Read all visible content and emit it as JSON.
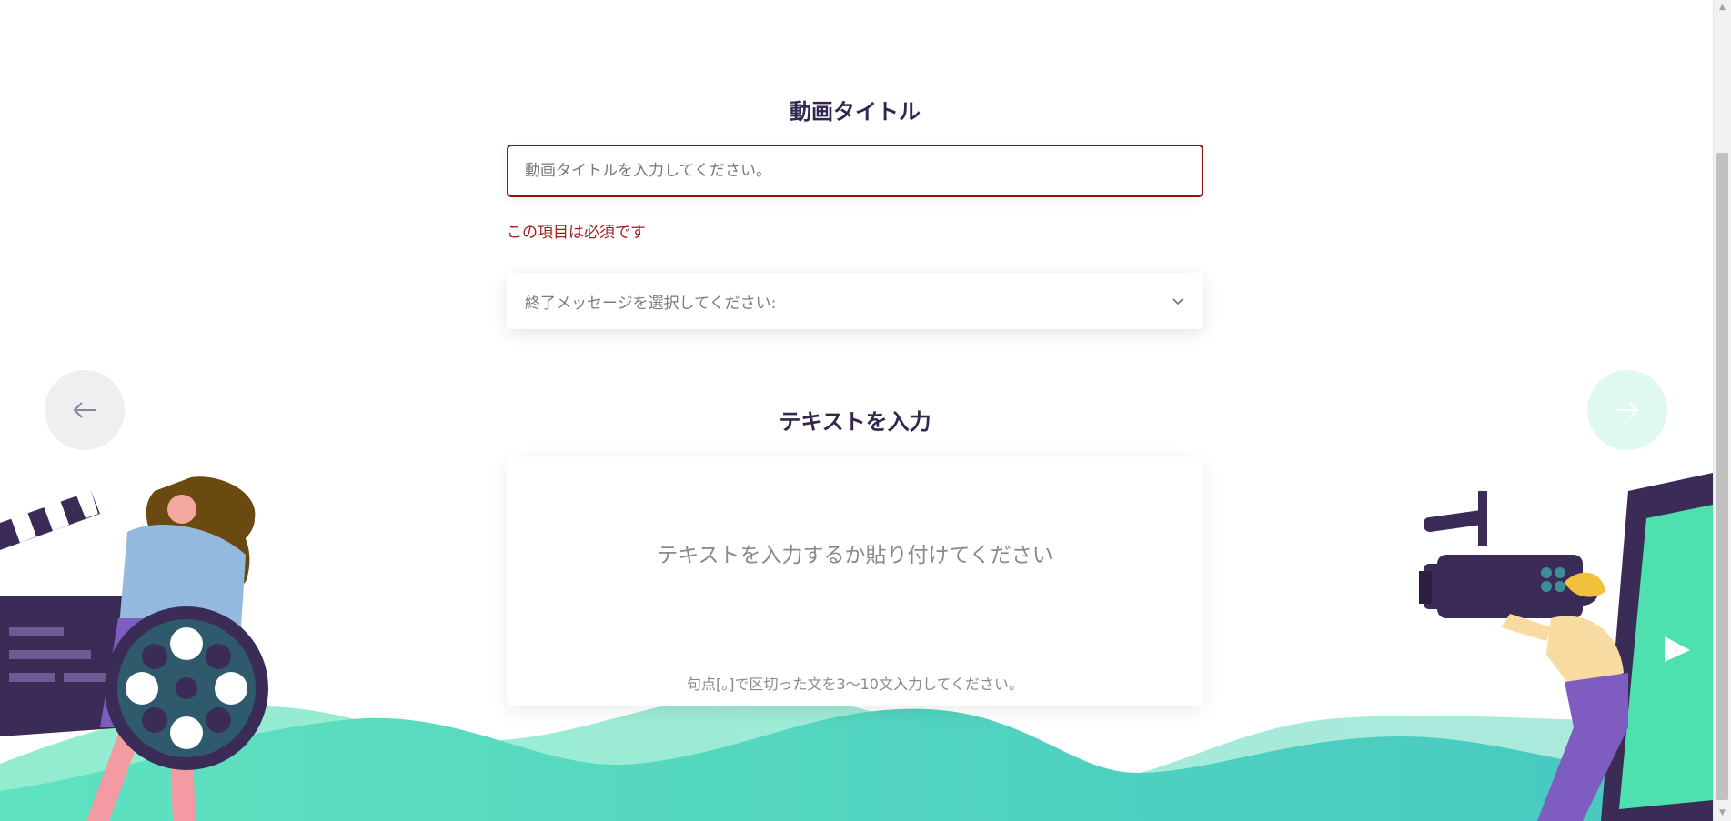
{
  "video_title": {
    "heading": "動画タイトル",
    "placeholder": "動画タイトルを入力してください。",
    "value": "",
    "error": "この項目は必須です"
  },
  "end_message": {
    "placeholder": "終了メッセージを選択してください:"
  },
  "text_entry": {
    "heading": "テキストを入力",
    "placeholder": "テキストを入力するか貼り付けてください",
    "hint": "句点[。]で区切った文を3～10文入力してください。"
  },
  "navigation": {
    "prev_icon": "arrow-left-icon",
    "next_icon": "arrow-right-icon"
  },
  "colors": {
    "heading": "#33264f",
    "error": "#9b1c1c",
    "wave_teal": "#4fd9b3",
    "accent_purple": "#7e5cc0",
    "dark_navy": "#3b2b57"
  }
}
